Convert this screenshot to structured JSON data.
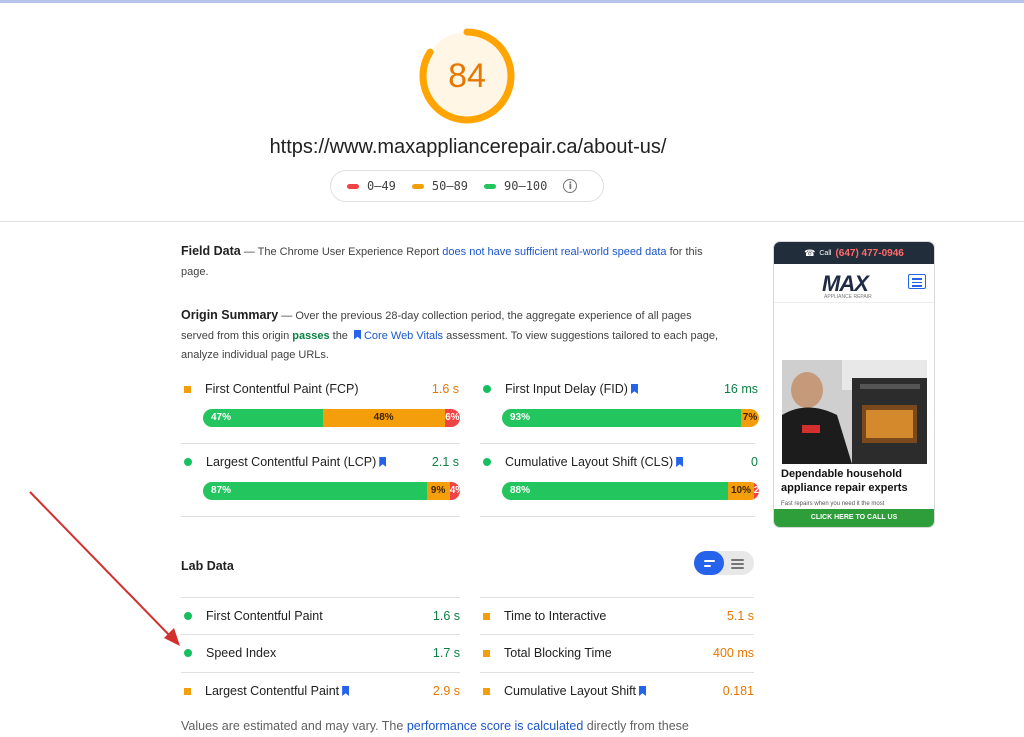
{
  "score": {
    "value": "84",
    "fraction": 0.84,
    "color": "#ffa400"
  },
  "url": "https://www.maxappliancerepair.ca/about-us/",
  "legend": [
    {
      "label": "0–49",
      "color": "#ef4444"
    },
    {
      "label": "50–89",
      "color": "#f59e0b"
    },
    {
      "label": "90–100",
      "color": "#22c55e"
    }
  ],
  "field_data": {
    "title": "Field Data",
    "text_before": " — The Chrome User Experience Report ",
    "link": "does not have sufficient real-world speed data",
    "text_after": " for this page."
  },
  "origin_summary": {
    "title": "Origin Summary",
    "text_before": " — Over the previous 28-day collection period, the aggregate experience of all pages served from this origin ",
    "passes": "passes",
    "text_mid": " the ",
    "link": "Core Web Vitals",
    "text_after": " assessment. To view suggestions tailored to each page, analyze individual page URLs."
  },
  "field_metrics": [
    {
      "name": "First Contentful Paint (FCP)",
      "value": "1.6 s",
      "marker": "square",
      "value_color": "#e67700",
      "bookmark": false,
      "dist": [
        {
          "pct": 47,
          "label": "47%"
        },
        {
          "pct": 48,
          "label": "48%"
        },
        {
          "pct": 6,
          "label": "6%"
        }
      ]
    },
    {
      "name": "First Input Delay (FID)",
      "value": "16 ms",
      "marker": "circle",
      "value_color": "#0b8043",
      "bookmark": true,
      "dist": [
        {
          "pct": 93,
          "label": "93%"
        },
        {
          "pct": 7,
          "label": "7%"
        },
        {
          "pct": 0,
          "label": ""
        }
      ]
    },
    {
      "name": "Largest Contentful Paint (LCP)",
      "value": "2.1 s",
      "marker": "circle",
      "value_color": "#0b8043",
      "bookmark": true,
      "dist": [
        {
          "pct": 87,
          "label": "87%"
        },
        {
          "pct": 9,
          "label": "9%"
        },
        {
          "pct": 4,
          "label": "4%"
        }
      ]
    },
    {
      "name": "Cumulative Layout Shift (CLS)",
      "value": "0",
      "marker": "circle",
      "value_color": "#0b8043",
      "bookmark": true,
      "dist": [
        {
          "pct": 88,
          "label": "88%"
        },
        {
          "pct": 10,
          "label": "10%"
        },
        {
          "pct": 2,
          "label": "2%"
        }
      ]
    }
  ],
  "lab_data": {
    "title": "Lab Data",
    "metrics": [
      {
        "name": "First Contentful Paint",
        "value": "1.6 s",
        "marker": "circle",
        "value_color": "#0b8043",
        "bookmark": false
      },
      {
        "name": "Time to Interactive",
        "value": "5.1 s",
        "marker": "square",
        "value_color": "#e67700",
        "bookmark": false
      },
      {
        "name": "Speed Index",
        "value": "1.7 s",
        "marker": "circle",
        "value_color": "#0b8043",
        "bookmark": false
      },
      {
        "name": "Total Blocking Time",
        "value": "400 ms",
        "marker": "square",
        "value_color": "#e67700",
        "bookmark": false
      },
      {
        "name": "Largest Contentful Paint",
        "value": "2.9 s",
        "marker": "square",
        "value_color": "#e67700",
        "bookmark": true
      },
      {
        "name": "Cumulative Layout Shift",
        "value": "0.181",
        "marker": "square",
        "value_color": "#e67700",
        "bookmark": true
      }
    ]
  },
  "footer": {
    "text_before": "Values are estimated and may vary. The ",
    "link": "performance score is calculated",
    "text_after": " directly from these"
  },
  "preview": {
    "call_label": "Call",
    "phone": "(647) 477-0946",
    "logo_main": "MAX",
    "logo_sub": "APPLIANCE REPAIR",
    "headline": "Dependable household appliance repair experts",
    "subtext": "Fast repairs when you need it the most",
    "cta": "CLICK HERE TO CALL US"
  },
  "colors": {
    "accent": "#1a56cc",
    "good": "#0b8043",
    "average": "#e67700",
    "arrow": "#d32f2f"
  }
}
